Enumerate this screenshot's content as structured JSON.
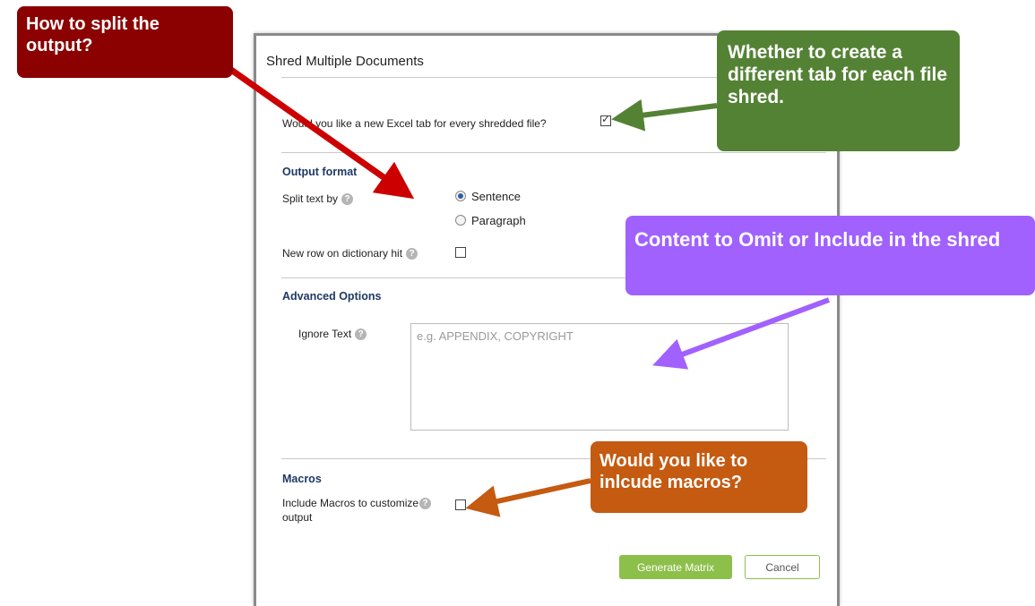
{
  "dialog": {
    "title": "Shred Multiple Documents",
    "new_tab_question": "Would you like a new Excel tab for every shredded file?",
    "new_tab_checked": true,
    "output_format": {
      "heading": "Output format",
      "split_label": "Split text by",
      "options": [
        "Sentence",
        "Paragraph"
      ],
      "selected": "Sentence",
      "new_row_label": "New row on dictionary hit",
      "new_row_checked": false
    },
    "advanced": {
      "heading": "Advanced Options",
      "ignore_label": "Ignore Text",
      "ignore_placeholder": "e.g. APPENDIX, COPYRIGHT",
      "ignore_value": ""
    },
    "macros": {
      "heading": "Macros",
      "include_label_line1": "Include Macros to customize",
      "include_label_line2": "output",
      "include_checked": false
    },
    "buttons": {
      "generate": "Generate Matrix",
      "cancel": "Cancel"
    },
    "help_glyph": "?"
  },
  "callouts": {
    "split": {
      "text": "How to split the output?",
      "color": "#8b0000"
    },
    "tab": {
      "text": "Whether to create a different tab for each file shred.",
      "color": "#548235"
    },
    "content": {
      "text": "Content to Omit or Include in the shred",
      "color": "#a061ff"
    },
    "macros": {
      "text": "Would you like to inlcude macros?",
      "color": "#c55a11"
    }
  },
  "colors": {
    "accent_green": "#8cc04a",
    "section_blue": "#1f3864"
  }
}
